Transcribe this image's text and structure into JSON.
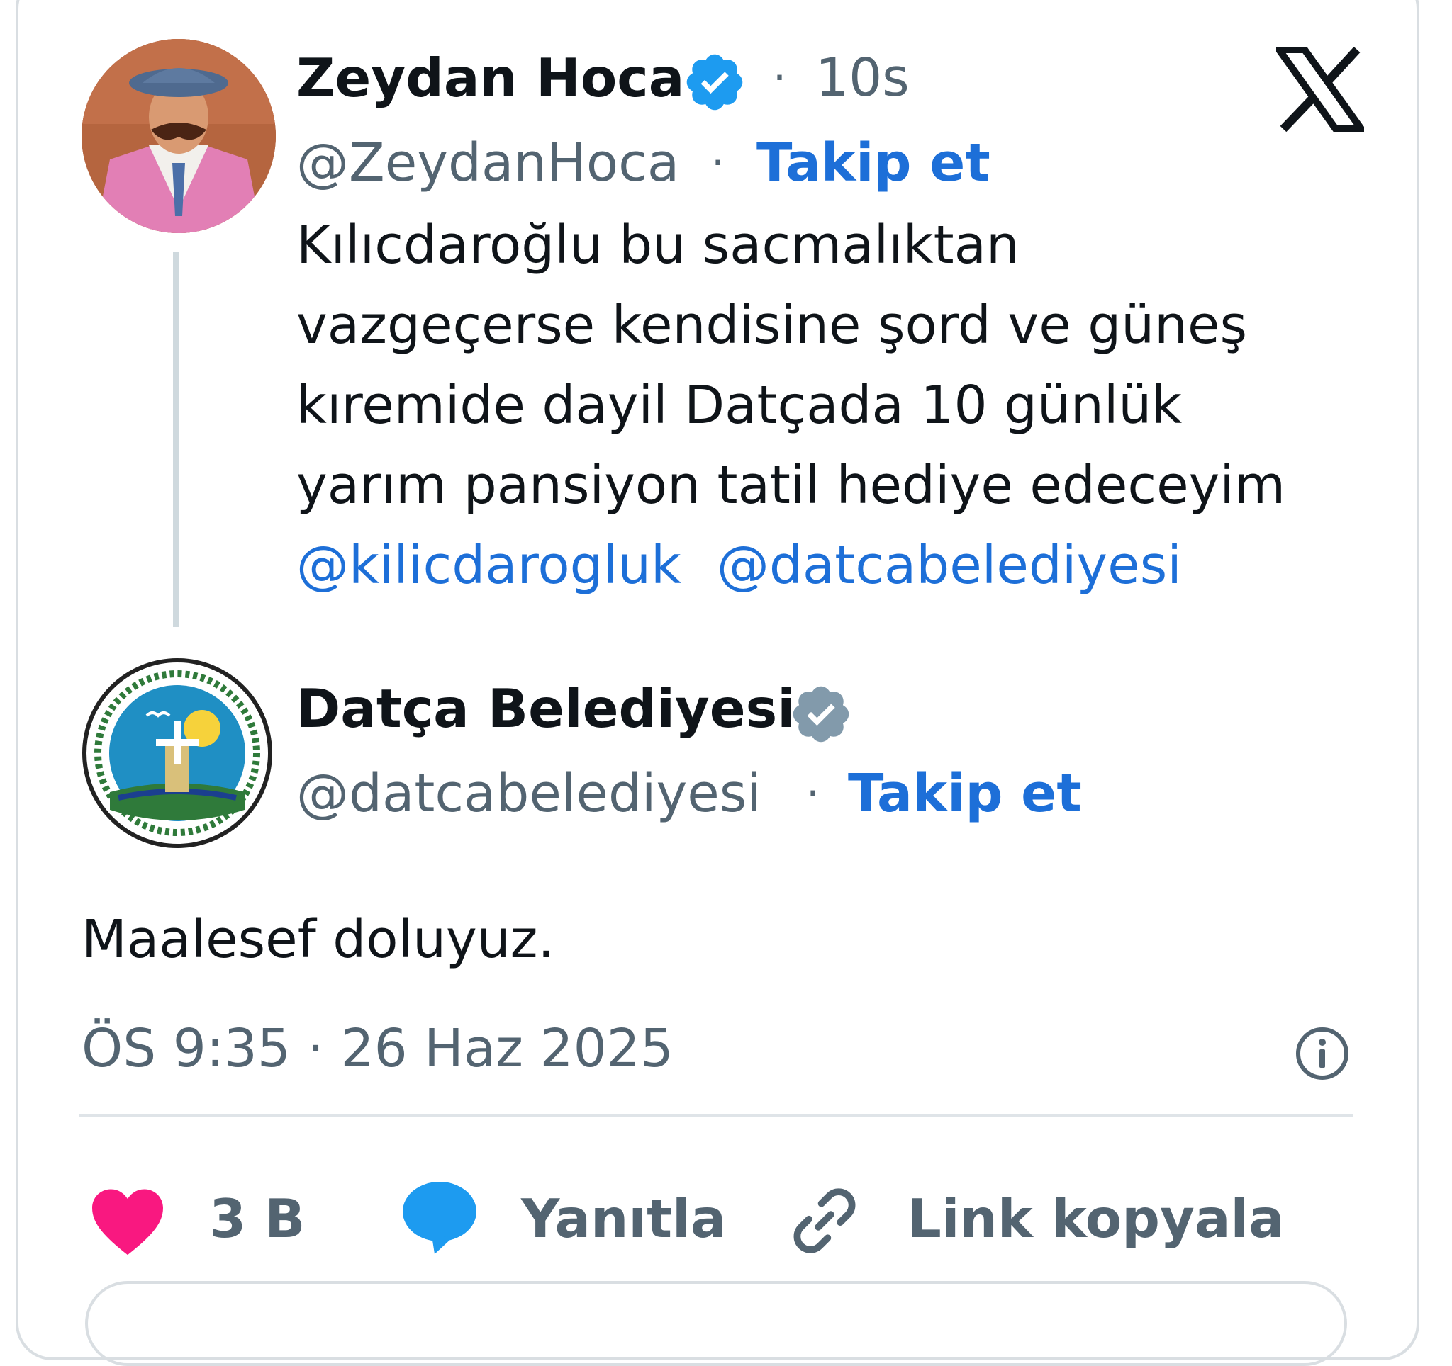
{
  "quoted_tweet": {
    "author_name": "Zeydan Hoca",
    "handle": "@ZeydanHoca",
    "separator": "·",
    "time_ago": "10s",
    "follow_label": "Takip et",
    "verified_badge_color": "#1d9bf0",
    "text_lines": [
      "Kılıcdaroğlu bu sacmalıktan",
      "vazgeçerse  kendisine şord ve güneş",
      "kıremide dayil Datçada  10 günlük",
      "yarım pansiyon tatil hediye edeceyim"
    ],
    "mentions": [
      "@kilicdarogluk",
      "@datcabelediyesi"
    ]
  },
  "reply_tweet": {
    "author_name": "Datça Belediyesi",
    "handle": "@datcabelediyesi",
    "separator": "·",
    "follow_label": "Takip et",
    "verified_badge_color": "#829aab",
    "text": "Maalesef doluyuz.",
    "timestamp": "ÖS 9:35 · 26 Haz 2025"
  },
  "actions": {
    "like_count": "3 B",
    "reply_label": "Yanıtla",
    "copy_link_label": "Link kopyala"
  },
  "colors": {
    "accent": "#1d6fd8",
    "like": "#f91880",
    "reply_bubble": "#1d9bf0",
    "muted": "#536471"
  },
  "icons": {
    "brand": "x-logo-icon",
    "verified": "verified-badge-icon",
    "info": "info-icon",
    "like": "heart-icon",
    "reply": "speech-bubble-icon",
    "link": "link-icon"
  }
}
